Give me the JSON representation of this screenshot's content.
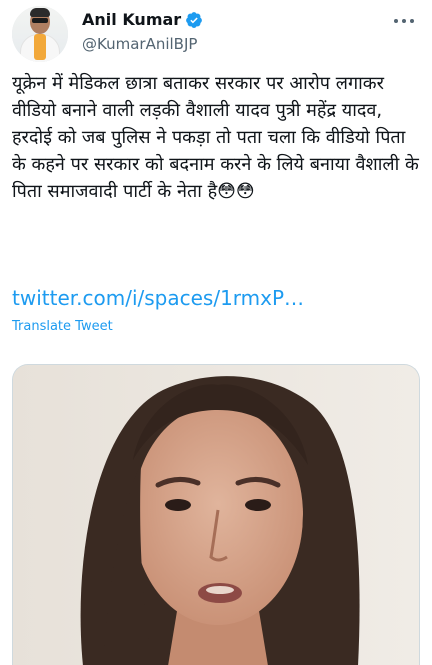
{
  "author": {
    "display_name": "Anil Kumar",
    "handle": "@KumarAnilBJP",
    "avatar_icon": "profile-photo",
    "verified_icon": "verified-badge-icon",
    "verified_color": "#1d9bf0"
  },
  "tweet": {
    "text": "यूक्रेन में मेडिकल छात्रा बताकर सरकार पर आरोप लगाकर वीडियो बनाने वाली लड़की वैशाली यादव पुत्री महेंद्र यादव, हरदोई को जब पुलिस ने पकड़ा तो पता चला कि वीडियो पिता के कहने पर सरकार को बदनाम करने के लिये बनाया वैशाली के पिता समाजवादी पार्टी के नेता है😳😳",
    "link": "twitter.com/i/spaces/1rmxP…",
    "translate_label": "Translate Tweet"
  },
  "media": {
    "type": "video-thumbnail"
  },
  "colors": {
    "link": "#1d9bf0",
    "secondary_text": "#536471",
    "text": "#0f1419"
  }
}
